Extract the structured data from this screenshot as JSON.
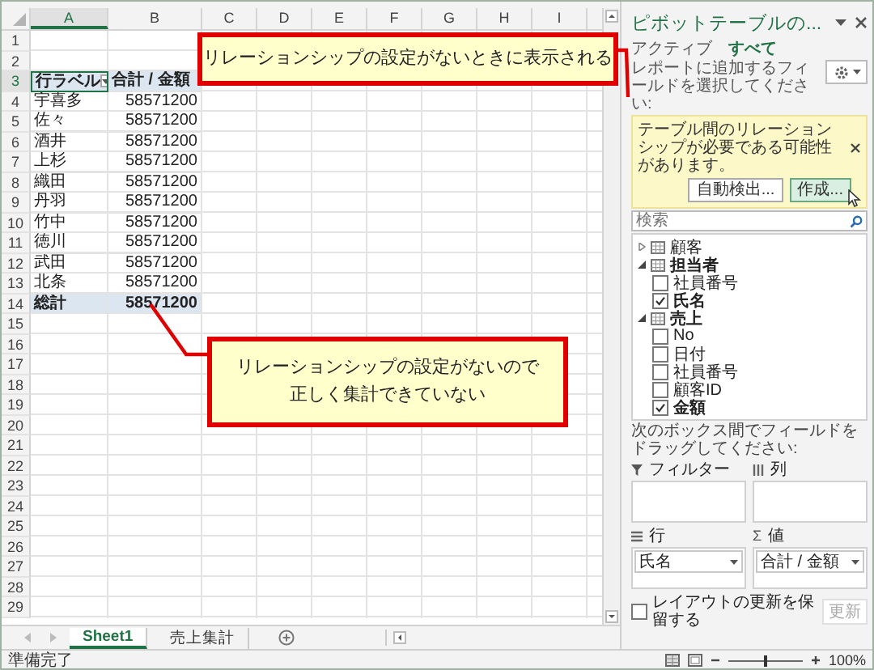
{
  "spreadsheet": {
    "columns": [
      "A",
      "B",
      "C",
      "D",
      "E",
      "F",
      "G",
      "H",
      "I"
    ],
    "row_numbers": [
      "1",
      "2",
      "3",
      "4",
      "5",
      "6",
      "7",
      "8",
      "9",
      "10",
      "11",
      "12",
      "13",
      "14",
      "15",
      "16",
      "17",
      "18",
      "19",
      "20",
      "21",
      "22",
      "23",
      "24",
      "25",
      "26",
      "27",
      "28",
      "29"
    ],
    "pivot": {
      "header": [
        "行ラベル",
        "合計 / 金額"
      ],
      "rows": [
        {
          "label": "宇喜多",
          "value": "58571200"
        },
        {
          "label": "佐々",
          "value": "58571200"
        },
        {
          "label": "酒井",
          "value": "58571200"
        },
        {
          "label": "上杉",
          "value": "58571200"
        },
        {
          "label": "織田",
          "value": "58571200"
        },
        {
          "label": "丹羽",
          "value": "58571200"
        },
        {
          "label": "竹中",
          "value": "58571200"
        },
        {
          "label": "徳川",
          "value": "58571200"
        },
        {
          "label": "武田",
          "value": "58571200"
        },
        {
          "label": "北条",
          "value": "58571200"
        }
      ],
      "total": {
        "label": "総計",
        "value": "58571200"
      }
    }
  },
  "sheet_tabs": [
    {
      "label": "Sheet1",
      "selected": true
    },
    {
      "label": "売上集計",
      "selected": false
    }
  ],
  "pivot_pane": {
    "title": "ピボットテーブルの...",
    "tabs": [
      {
        "label": "アクティブ",
        "selected": false
      },
      {
        "label": "すべて",
        "selected": true
      }
    ],
    "instruction": "レポートに追加するフィールドを選択してください:",
    "notice": {
      "text": "テーブル間のリレーションシップが必要である可能性があります。",
      "buttons": [
        {
          "label": "自動検出...",
          "hovered": false
        },
        {
          "label": "作成...",
          "hovered": true
        }
      ]
    },
    "search": {
      "placeholder": "検索"
    },
    "tables": [
      {
        "name": "顧客",
        "expanded": false
      },
      {
        "name": "担当者",
        "expanded": true,
        "children": [
          {
            "name": "社員番号",
            "checked": false
          },
          {
            "name": "氏名",
            "checked": true
          }
        ]
      },
      {
        "name": "売上",
        "expanded": true,
        "children": [
          {
            "name": "No",
            "checked": false
          },
          {
            "name": "日付",
            "checked": false
          },
          {
            "name": "社員番号",
            "checked": false
          },
          {
            "name": "顧客ID",
            "checked": false
          },
          {
            "name": "金額",
            "checked": true
          }
        ]
      }
    ],
    "areas_hint": "次のボックス間でフィールドをドラッグしてください:",
    "areas": [
      {
        "kind": "filter",
        "label": "フィルター"
      },
      {
        "kind": "columns",
        "label": "列"
      },
      {
        "kind": "rows",
        "label": "行",
        "items": [
          "氏名"
        ]
      },
      {
        "kind": "values",
        "label": "値",
        "symbol": "Σ",
        "items": [
          "合計 / 金額"
        ]
      }
    ],
    "defer": {
      "label": "レイアウトの更新を保留する",
      "checked": false
    },
    "update_button": {
      "label": "更新",
      "disabled": true
    }
  },
  "status_bar": {
    "text": "準備完了",
    "zoom": {
      "level": 0.5,
      "reading": "100%"
    }
  },
  "callouts": [
    {
      "lines": [
        "リレーションシップの設定がないときに表示される"
      ]
    },
    {
      "lines": [
        "リレーションシップの設定がないので",
        "正しく集計できていない"
      ]
    }
  ]
}
